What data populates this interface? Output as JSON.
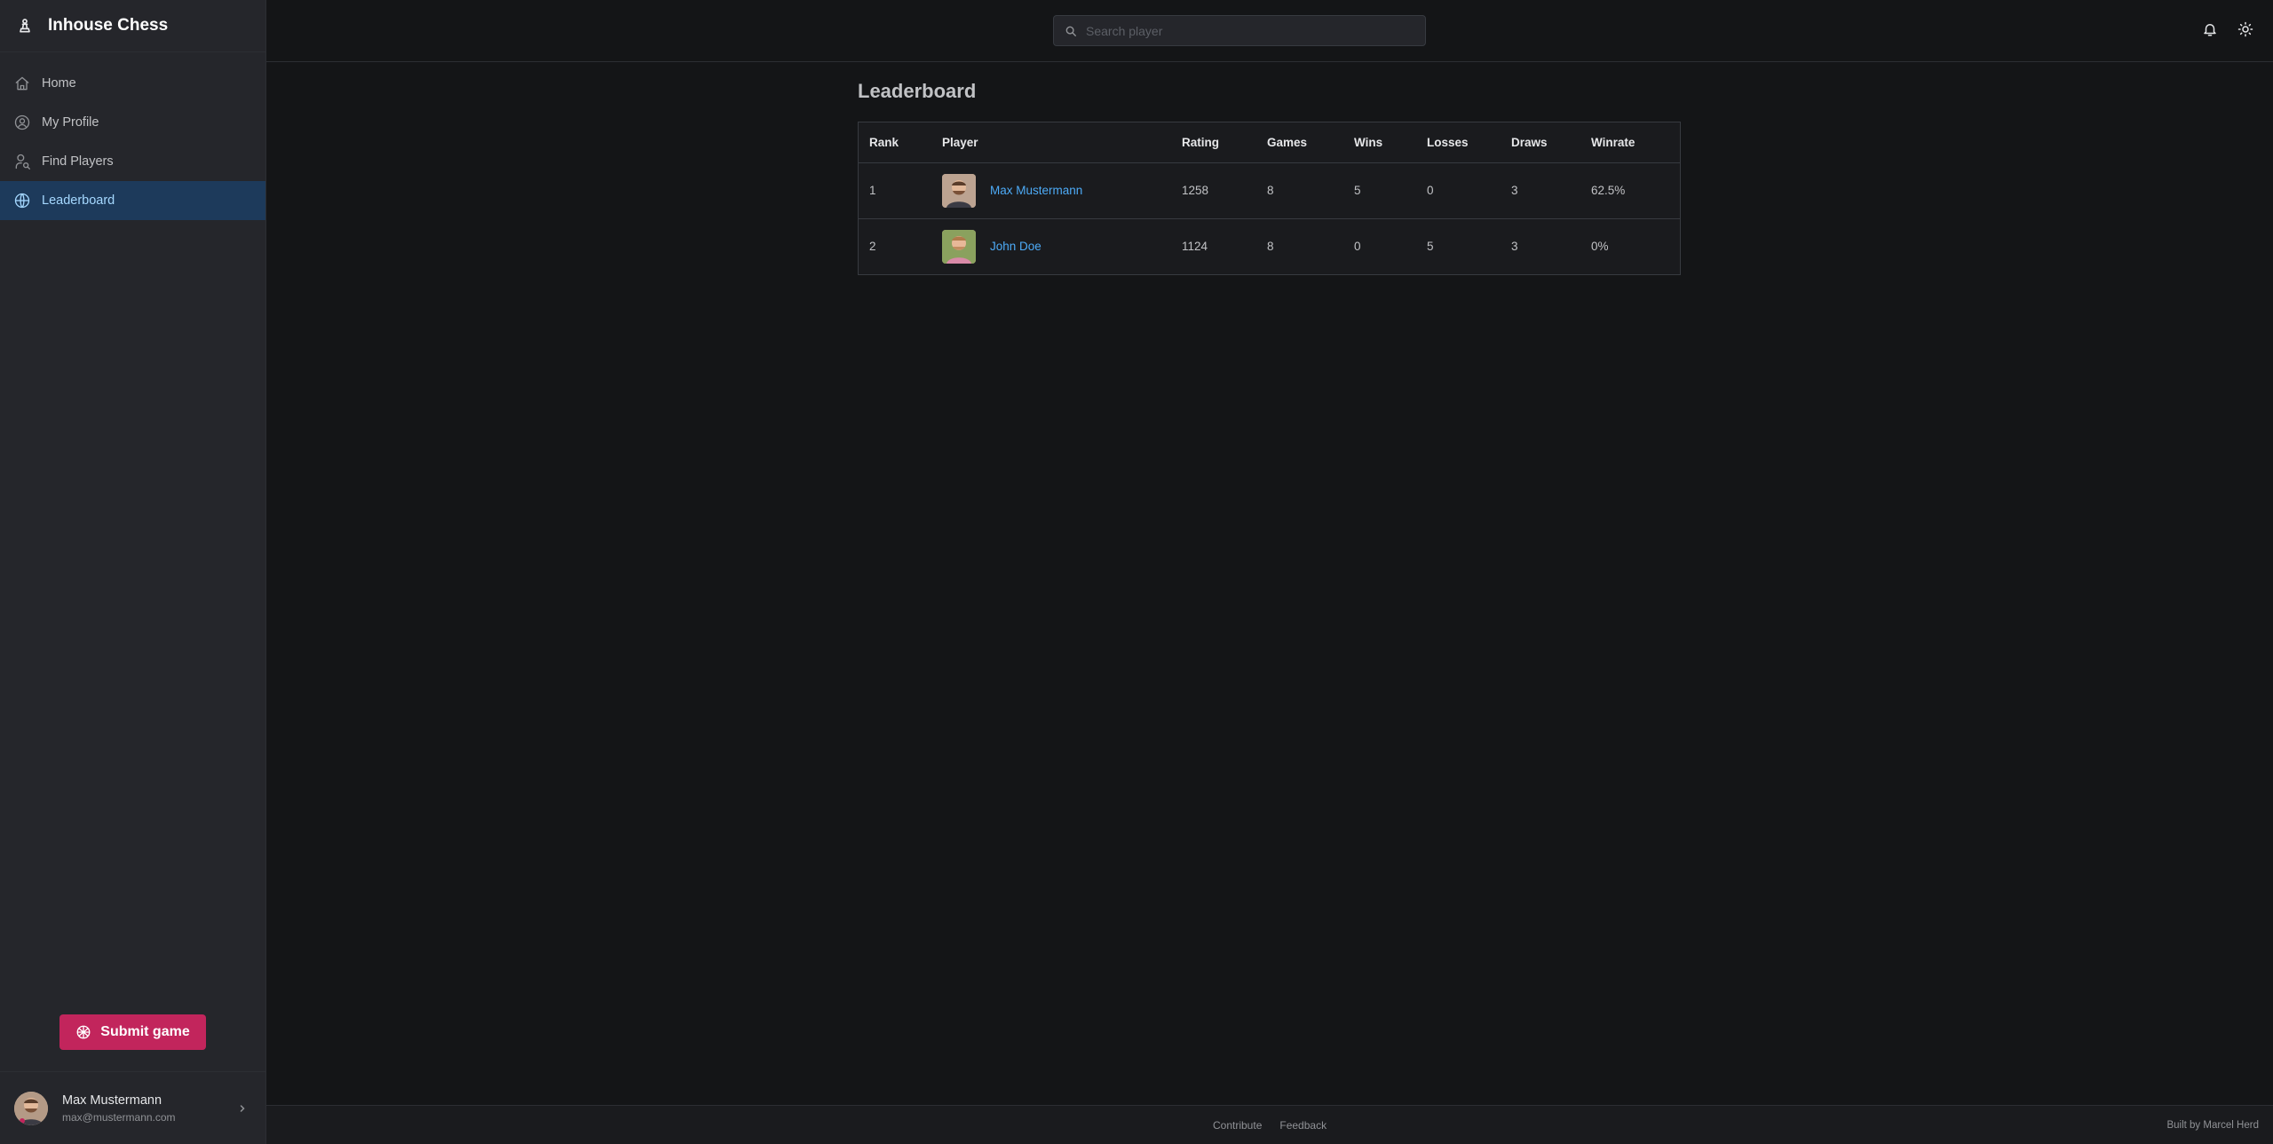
{
  "app": {
    "name": "Inhouse Chess",
    "logo_icon": "chess-pawn-icon"
  },
  "sidebar": {
    "items": [
      {
        "label": "Home",
        "icon": "home-icon",
        "active": false
      },
      {
        "label": "My Profile",
        "icon": "user-circle-icon",
        "active": false
      },
      {
        "label": "Find Players",
        "icon": "user-search-icon",
        "active": false
      },
      {
        "label": "Leaderboard",
        "icon": "globe-icon",
        "active": true
      }
    ],
    "submit_label": "Submit game",
    "user": {
      "name": "Max Mustermann",
      "email": "max@mustermann.com"
    }
  },
  "header": {
    "search_placeholder": "Search player"
  },
  "main": {
    "title": "Leaderboard",
    "columns": [
      "Rank",
      "Player",
      "Rating",
      "Games",
      "Wins",
      "Losses",
      "Draws",
      "Winrate"
    ],
    "rows": [
      {
        "rank": "1",
        "player": "Max Mustermann",
        "rating": "1258",
        "games": "8",
        "wins": "5",
        "losses": "0",
        "draws": "3",
        "winrate": "62.5%"
      },
      {
        "rank": "2",
        "player": "John Doe",
        "rating": "1124",
        "games": "8",
        "wins": "0",
        "losses": "5",
        "draws": "3",
        "winrate": "0%"
      }
    ]
  },
  "footer": {
    "links": [
      "Contribute",
      "Feedback"
    ],
    "credit": "Built by Marcel Herd"
  },
  "colors": {
    "accent": "#c2255c",
    "link": "#4dabf7",
    "active_bg": "#1d3a5b"
  }
}
